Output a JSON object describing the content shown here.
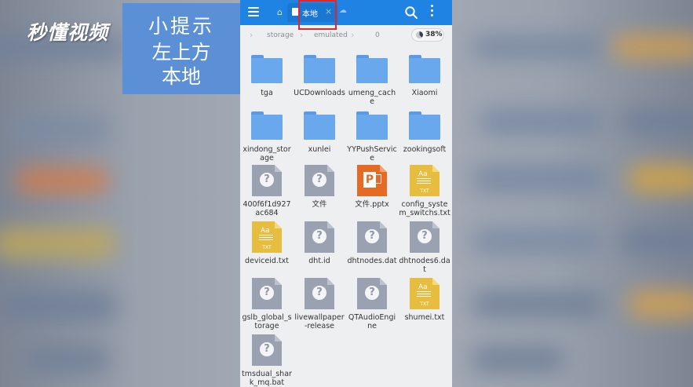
{
  "watermark": {
    "logo_text": "秒懂视频"
  },
  "tip": {
    "title": "小提示",
    "line1": "左上方",
    "line2": "本地"
  },
  "topbar": {
    "tab_label": "本地",
    "tab_close": "×"
  },
  "path": {
    "crumbs": [
      "storage",
      "emulated",
      "0"
    ],
    "storage_percent": "38%"
  },
  "files": [
    {
      "name": "tga",
      "type": "folder"
    },
    {
      "name": "UCDownloads",
      "type": "folder"
    },
    {
      "name": "umeng_cache",
      "type": "folder"
    },
    {
      "name": "Xiaomi",
      "type": "folder"
    },
    {
      "name": "xindong_storage",
      "type": "folder"
    },
    {
      "name": "xunlei",
      "type": "folder"
    },
    {
      "name": "YYPushService",
      "type": "folder"
    },
    {
      "name": "zookingsoft",
      "type": "folder"
    },
    {
      "name": "400f6f1d927ac684",
      "type": "unknown"
    },
    {
      "name": "文件",
      "type": "unknown"
    },
    {
      "name": "文件.pptx",
      "type": "pptx"
    },
    {
      "name": "config_system_switchs.txt",
      "type": "txt"
    },
    {
      "name": "deviceid.txt",
      "type": "txt"
    },
    {
      "name": "dht.id",
      "type": "unknown"
    },
    {
      "name": "dhtnodes.dat",
      "type": "unknown"
    },
    {
      "name": "dhtnodes6.dat",
      "type": "unknown"
    },
    {
      "name": "gslb_global_storage",
      "type": "unknown"
    },
    {
      "name": "livewallpaper-release",
      "type": "unknown"
    },
    {
      "name": "QTAudioEngine",
      "type": "unknown"
    },
    {
      "name": "shumei.txt",
      "type": "txt"
    },
    {
      "name": "tmsdual_shark_mq.bat",
      "type": "unknown"
    }
  ],
  "icons": {
    "menu": "menu-icon",
    "home": "home-icon",
    "tab": "document-icon",
    "cloud": "cloud-icon",
    "search": "search-icon",
    "more": "more-vertical-icon",
    "storage": "pie-chart-icon"
  },
  "colors": {
    "accent": "#1f83e3",
    "folder": "#6aa8ee",
    "tip_bg": "#5b8fd6",
    "highlight": "#e0262d",
    "txt": "#e7bd3f",
    "pptx": "#e56b24"
  }
}
